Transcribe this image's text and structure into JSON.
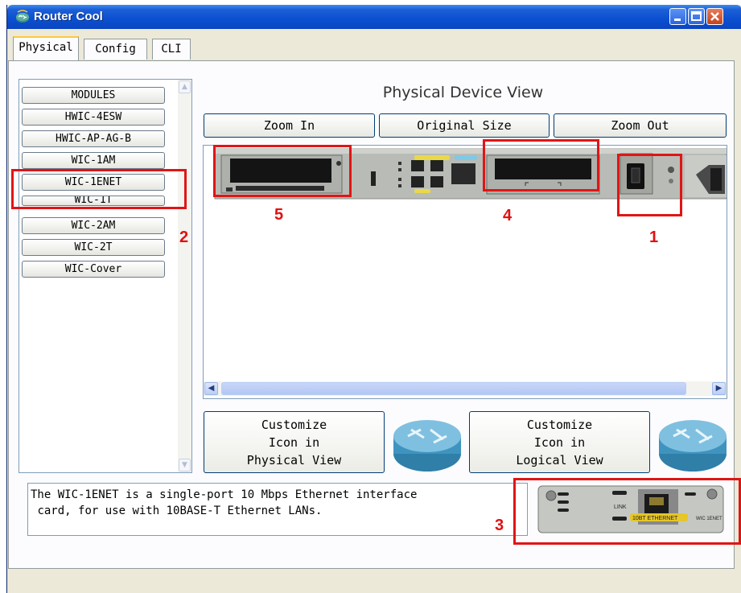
{
  "window": {
    "title": "Router Cool"
  },
  "tabs": [
    {
      "label": "Physical",
      "active": true
    },
    {
      "label": "Config",
      "active": false
    },
    {
      "label": "CLI",
      "active": false
    }
  ],
  "modules": [
    "MODULES",
    "HWIC-4ESW",
    "HWIC-AP-AG-B",
    "WIC-1AM",
    "WIC-1ENET",
    "WIC-1T",
    "WIC-2AM",
    "WIC-2T",
    "WIC-Cover"
  ],
  "selected_module": "WIC-1ENET",
  "physical_view": {
    "title": "Physical Device View",
    "zoom_in": "Zoom In",
    "original_size": "Original Size",
    "zoom_out": "Zoom Out"
  },
  "customize": {
    "physical": [
      "Customize",
      "Icon in",
      "Physical View"
    ],
    "logical": [
      "Customize",
      "Icon in",
      "Logical View"
    ]
  },
  "description": "The WIC-1ENET is a single-port 10 Mbps Ethernet interface\n card, for use with 10BASE-T Ethernet LANs.",
  "module_card": {
    "label_link": "LINK",
    "label_ethernet": "10BT ETHERNET",
    "label_model": "WIC 1ENET"
  },
  "annotations": {
    "power_switch": "1",
    "module_list": "2",
    "module_preview": "3",
    "slot_right": "4",
    "slot_left": "5"
  },
  "colors": {
    "titlebar": "#0b4fd1",
    "highlight": "#e01515",
    "tab_accent": "#ffc83c"
  },
  "icons": [
    "router-app-icon",
    "minimize-icon",
    "maximize-icon",
    "close-icon",
    "router-icon"
  ]
}
